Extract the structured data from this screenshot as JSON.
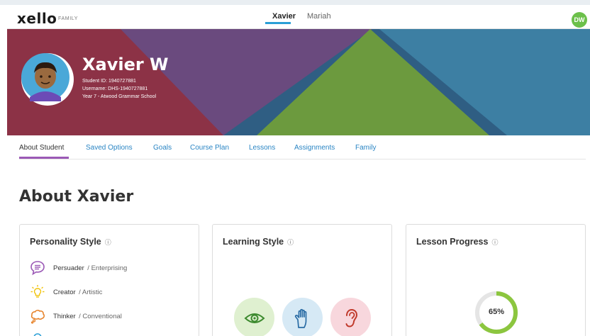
{
  "header": {
    "logo": "xello",
    "logo_sub": "FAMILY",
    "students": [
      "Xavier",
      "Mariah"
    ],
    "user_initials": "DW",
    "accent": "#2a9fd6"
  },
  "profile": {
    "name": "Xavier W",
    "student_id": "Student ID: 1940727881",
    "username": "Username: DHS-1940727881",
    "school": "Year 7 - Atwood Grammar School"
  },
  "tabs": [
    "About Student",
    "Saved Options",
    "Goals",
    "Course Plan",
    "Lessons",
    "Assignments",
    "Family"
  ],
  "page_title": "About Xavier",
  "cards": {
    "personality": {
      "title": "Personality Style",
      "items": [
        {
          "name": "Persuader",
          "type": "/ Enterprising",
          "icon": "speech-bubble-icon",
          "color": "#9b59b6"
        },
        {
          "name": "Creator",
          "type": "/ Artistic",
          "icon": "lightbulb-icon",
          "color": "#f1c40f"
        },
        {
          "name": "Thinker",
          "type": "/ Conventional",
          "icon": "thought-cloud-icon",
          "color": "#e67e22"
        }
      ]
    },
    "learning": {
      "title": "Learning Style",
      "styles": [
        {
          "icon": "eye-icon",
          "bg": "#dff0d0",
          "fg": "#3c8a2e"
        },
        {
          "icon": "hand-icon",
          "bg": "#d6e9f5",
          "fg": "#2a6ca5"
        },
        {
          "icon": "ear-icon",
          "bg": "#f8d7dd",
          "fg": "#c0392b"
        }
      ]
    },
    "progress": {
      "title": "Lesson Progress",
      "percent_label": "65%",
      "value": 0.65,
      "color": "#8cc63f"
    }
  }
}
